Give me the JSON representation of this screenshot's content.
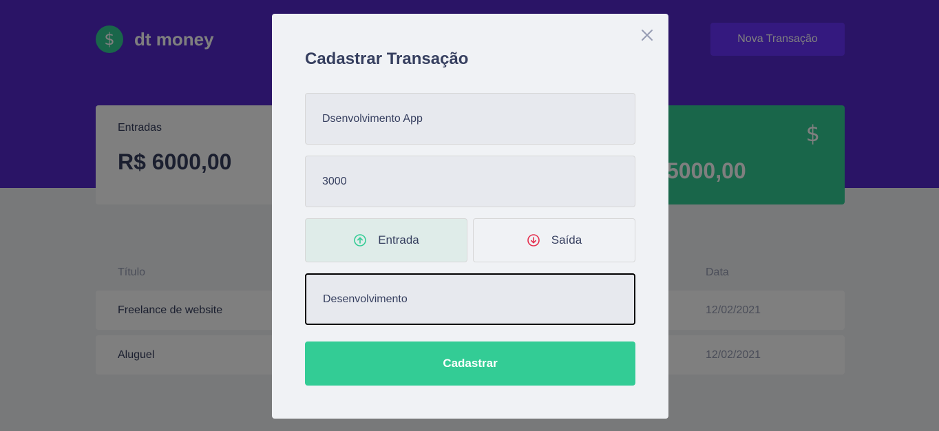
{
  "app": {
    "logo_symbol": "$",
    "name": "dt money",
    "new_transaction_label": "Nova Transação"
  },
  "summary": {
    "income": {
      "label": "Entradas",
      "value": "R$ 6000,00"
    },
    "total": {
      "icon": "dollar-sign-icon",
      "symbol": "$",
      "value": "5000,00"
    }
  },
  "table": {
    "headers": {
      "title": "Título",
      "date": "Data"
    },
    "rows": [
      {
        "title": "Freelance de website",
        "date": "12/02/2021"
      },
      {
        "title": "Aluguel",
        "date": "12/02/2021"
      }
    ]
  },
  "modal": {
    "title": "Cadastrar Transação",
    "fields": {
      "title_value": "Dsenvolvimento App",
      "amount_value": "3000",
      "category_value": "Desenvolvimento"
    },
    "types": {
      "income_label": "Entrada",
      "outcome_label": "Saída"
    },
    "submit_label": "Cadastrar"
  },
  "colors": {
    "header": "#5429cc",
    "accent_green": "#33cc95",
    "accent_red": "#e52e4d",
    "button_purple": "#6933ff"
  }
}
